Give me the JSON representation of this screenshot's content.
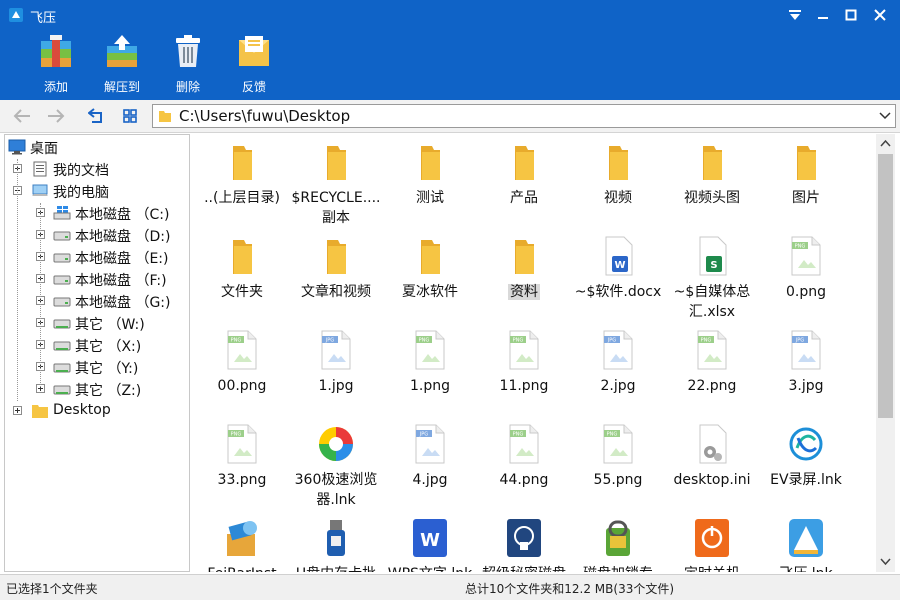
{
  "window": {
    "title": "飞压"
  },
  "toolbar": {
    "buttons": [
      {
        "id": "add",
        "label": "添加",
        "icon": "archive-add-icon"
      },
      {
        "id": "extract",
        "label": "解压到",
        "icon": "extract-icon"
      },
      {
        "id": "delete",
        "label": "删除",
        "icon": "trash-icon"
      },
      {
        "id": "feedback",
        "label": "反馈",
        "icon": "feedback-mail-icon"
      }
    ]
  },
  "address": {
    "path": "C:\\Users\\fuwu\\Desktop"
  },
  "tree": {
    "root": "桌面",
    "documents": "我的文档",
    "computer": "我的电脑",
    "drives": [
      {
        "label": "本地磁盘 （C:)",
        "kind": "windows"
      },
      {
        "label": "本地磁盘 （D:)",
        "kind": "disk"
      },
      {
        "label": "本地磁盘 （E:)",
        "kind": "disk"
      },
      {
        "label": "本地磁盘 （F:)",
        "kind": "disk"
      },
      {
        "label": "本地磁盘 （G:)",
        "kind": "disk"
      },
      {
        "label": "其它 （W:)",
        "kind": "net"
      },
      {
        "label": "其它 （X:)",
        "kind": "net"
      },
      {
        "label": "其它 （Y:)",
        "kind": "net"
      },
      {
        "label": "其它 （Z:)",
        "kind": "net"
      }
    ],
    "desktop": "Desktop"
  },
  "files": [
    {
      "name": "..(上层目录)",
      "type": "folder"
    },
    {
      "name": "$RECYCLE.... 副本",
      "type": "folder"
    },
    {
      "name": "测试",
      "type": "folder"
    },
    {
      "name": "产品",
      "type": "folder"
    },
    {
      "name": "视频",
      "type": "folder"
    },
    {
      "name": "视频头图",
      "type": "folder"
    },
    {
      "name": "图片",
      "type": "folder"
    },
    {
      "name": "文件夹",
      "type": "folder"
    },
    {
      "name": "文章和视频",
      "type": "folder"
    },
    {
      "name": "夏冰软件",
      "type": "folder"
    },
    {
      "name": "资料",
      "type": "folder",
      "selected": true
    },
    {
      "name": "~$软件.docx",
      "type": "docx"
    },
    {
      "name": "~$自媒体总 汇.xlsx",
      "type": "xlsx"
    },
    {
      "name": "0.png",
      "type": "png"
    },
    {
      "name": "00.png",
      "type": "png"
    },
    {
      "name": "1.jpg",
      "type": "jpg"
    },
    {
      "name": "1.png",
      "type": "png"
    },
    {
      "name": "11.png",
      "type": "png"
    },
    {
      "name": "2.jpg",
      "type": "jpg"
    },
    {
      "name": "22.png",
      "type": "png"
    },
    {
      "name": "3.jpg",
      "type": "jpg"
    },
    {
      "name": "33.png",
      "type": "png"
    },
    {
      "name": "360极速浏览 器.lnk",
      "type": "browser360"
    },
    {
      "name": "4.jpg",
      "type": "jpg"
    },
    {
      "name": "44.png",
      "type": "png"
    },
    {
      "name": "55.png",
      "type": "png"
    },
    {
      "name": "desktop.ini",
      "type": "ini"
    },
    {
      "name": "EV录屏.lnk",
      "type": "ev"
    },
    {
      "name": "FeiRarInst",
      "type": "installer"
    },
    {
      "name": "U盘内存卡批",
      "type": "usb"
    },
    {
      "name": "WPS文字.lnk",
      "type": "wps"
    },
    {
      "name": "超级秘密磁盘",
      "type": "secretdisk"
    },
    {
      "name": "磁盘加锁专",
      "type": "disklock"
    },
    {
      "name": "定时关机",
      "type": "shutdown"
    },
    {
      "name": "飞压.lnk",
      "type": "feiya"
    }
  ],
  "status": {
    "selection": "已选择1个文件夹",
    "summary": "总计10个文件夹和12.2 MB(33个文件)"
  },
  "colors": {
    "accent": "#0f63c7",
    "folder": "#f6c543"
  }
}
